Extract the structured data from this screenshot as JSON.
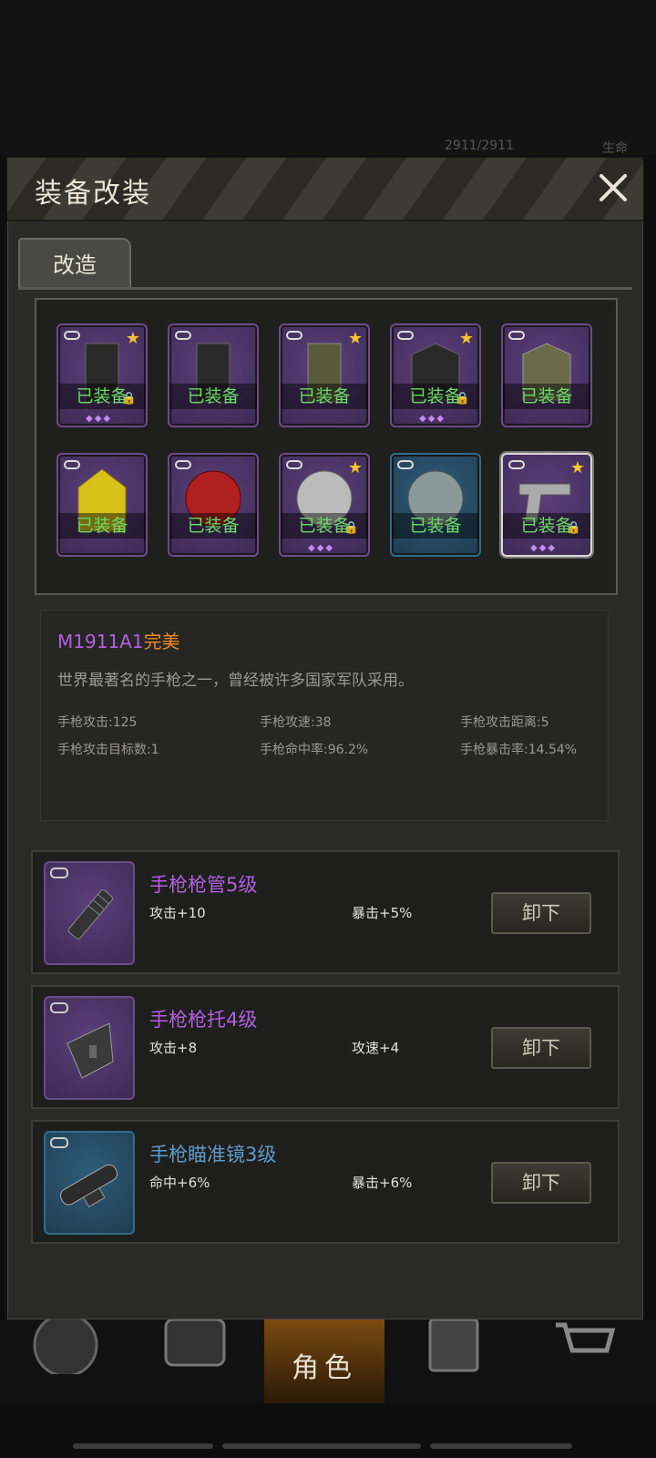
{
  "background": {
    "status_hp": "2911/2911",
    "status_label": "生命"
  },
  "dialog": {
    "title": "装备改装",
    "tab": "改造",
    "slots": [
      {
        "equip_label": "已装备",
        "star": true,
        "locked": true,
        "gems": "◆◆◆",
        "frame": "purple"
      },
      {
        "equip_label": "已装备",
        "star": false,
        "locked": false,
        "gems": "",
        "frame": "purple"
      },
      {
        "equip_label": "已装备",
        "star": true,
        "locked": false,
        "gems": "",
        "frame": "purple"
      },
      {
        "equip_label": "已装备",
        "star": true,
        "locked": true,
        "gems": "◆◆◆",
        "frame": "purple"
      },
      {
        "equip_label": "已装备",
        "star": false,
        "locked": false,
        "gems": "",
        "frame": "purple"
      },
      {
        "equip_label": "已装备",
        "star": false,
        "locked": false,
        "gems": "",
        "frame": "purple"
      },
      {
        "equip_label": "已装备",
        "star": false,
        "locked": false,
        "gems": "",
        "frame": "purple"
      },
      {
        "equip_label": "已装备",
        "star": true,
        "locked": true,
        "gems": "◆◆◆",
        "frame": "purple"
      },
      {
        "equip_label": "已装备",
        "star": false,
        "locked": false,
        "gems": "",
        "frame": "blue"
      },
      {
        "equip_label": "已装备",
        "star": true,
        "locked": true,
        "gems": "◆◆◆",
        "frame": "purple",
        "selected": true
      }
    ],
    "item": {
      "name": "M1911A1",
      "quality": "完美",
      "description": "世界最著名的手枪之一，曾经被许多国家军队采用。",
      "stats": [
        "手枪攻击:125",
        "手枪攻速:38",
        "手枪攻击距离:5",
        "手枪攻击目标数:1",
        "手枪命中率:96.2%",
        "手枪暴击率:14.54%"
      ]
    },
    "mods": [
      {
        "name": "手枪枪管5级",
        "stat1": "攻击+10",
        "stat2": "暴击+5%",
        "button": "卸下",
        "frame": "purple",
        "color": "#b25fe0"
      },
      {
        "name": "手枪枪托4级",
        "stat1": "攻击+8",
        "stat2": "攻速+4",
        "button": "卸下",
        "frame": "purple",
        "color": "#b25fe0"
      },
      {
        "name": "手枪瞄准镜3级",
        "stat1": "命中+6%",
        "stat2": "暴击+6%",
        "button": "卸下",
        "frame": "blue",
        "color": "#5d9bc9"
      }
    ]
  },
  "bottom_nav": {
    "selected_label": "角色"
  },
  "colors": {
    "equip_green": "#6fd86a",
    "purple_name": "#b25fe0",
    "orange_quality": "#f08a1e",
    "star": "#f4c430"
  }
}
